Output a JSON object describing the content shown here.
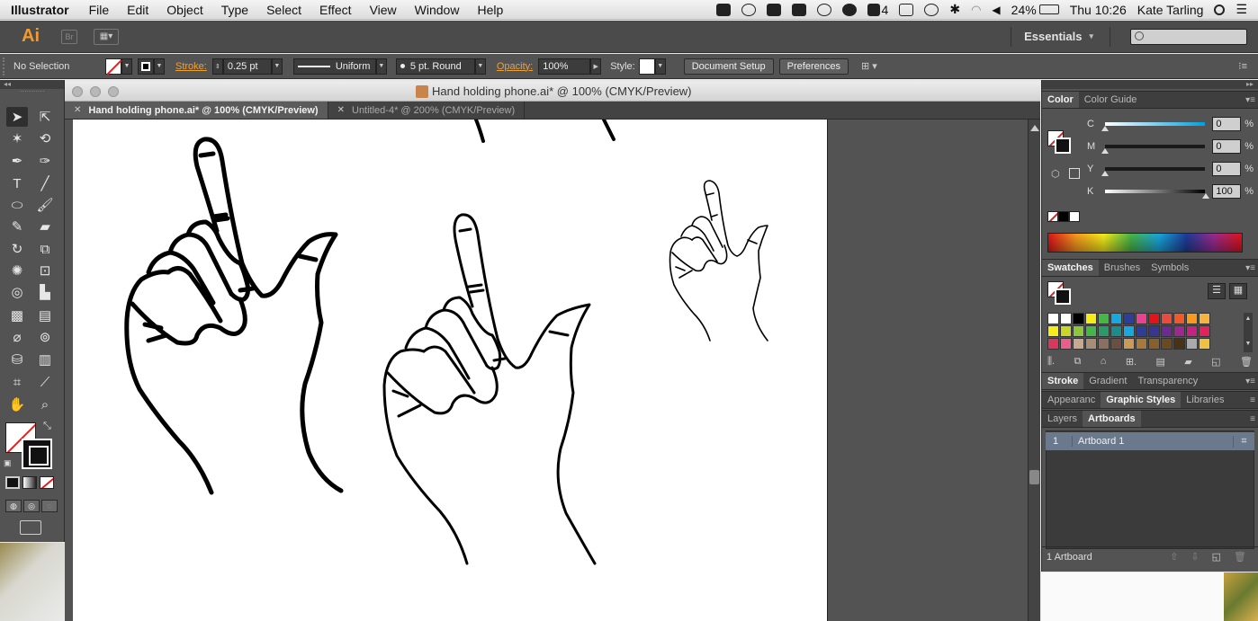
{
  "menubar": {
    "app": "Illustrator",
    "items": [
      "File",
      "Edit",
      "Object",
      "Type",
      "Select",
      "Effect",
      "View",
      "Window",
      "Help"
    ],
    "adobe_badge": "4",
    "battery": "24%",
    "clock": "Thu 10:26",
    "user": "Kate Tarling"
  },
  "appbar": {
    "logo": "Ai",
    "bridge": "Br",
    "workspace": "Essentials"
  },
  "control": {
    "selection": "No Selection",
    "stroke_label": "Stroke:",
    "stroke_weight": "0.25 pt",
    "profile": "Uniform",
    "brush": "5 pt. Round",
    "opacity_label": "Opacity:",
    "opacity": "100%",
    "style_label": "Style:",
    "document_setup": "Document Setup",
    "preferences": "Preferences"
  },
  "document": {
    "window_title": "Hand holding phone.ai* @ 100% (CMYK/Preview)",
    "tabs": [
      {
        "label": "Hand holding phone.ai* @ 100% (CMYK/Preview)",
        "active": true
      },
      {
        "label": "Untitled-4* @ 200% (CMYK/Preview)",
        "active": false
      }
    ]
  },
  "panels": {
    "color_tabs": [
      "Color",
      "Color Guide"
    ],
    "cmyk": [
      {
        "label": "C",
        "value": "0",
        "level": 0
      },
      {
        "label": "M",
        "value": "0",
        "level": 0
      },
      {
        "label": "Y",
        "value": "0",
        "level": 0
      },
      {
        "label": "K",
        "value": "100",
        "level": 1
      }
    ],
    "pct": "%",
    "swatch_tabs": [
      "Swatches",
      "Brushes",
      "Symbols"
    ],
    "stroke_tabs": [
      "Stroke",
      "Gradient",
      "Transparency"
    ],
    "appearance_tabs": [
      "Appearanc",
      "Graphic Styles",
      "Libraries"
    ],
    "layer_tabs": [
      "Layers",
      "Artboards"
    ],
    "artboards": [
      {
        "num": "1",
        "name": "Artboard 1"
      }
    ],
    "footer": "1 Artboard"
  },
  "swatch_colors": [
    "#ffffff",
    "#ffffff",
    "#000000",
    "#f5ec1a",
    "#46b649",
    "#1aa6de",
    "#2c3e98",
    "#e84393",
    "#e0141b",
    "#e74c3c",
    "#f0592a",
    "#f79a1e",
    "#f5b341",
    "#f5ec1a",
    "#c8d62a",
    "#8cc63e",
    "#46b649",
    "#2a9a6a",
    "#1e8a8a",
    "#1aa6de",
    "#2c3e98",
    "#3a3590",
    "#6a2c91",
    "#9b2a8f",
    "#c0267f",
    "#e0245e",
    "#d9385e",
    "#e85f8a",
    "#c8a98e",
    "#a98e76",
    "#8a7060",
    "#6a5040",
    "#c99a5a",
    "#a6793f",
    "#87602e",
    "#6a4a22",
    "#4a3215",
    "#aaaaaa",
    "#f0c040"
  ]
}
